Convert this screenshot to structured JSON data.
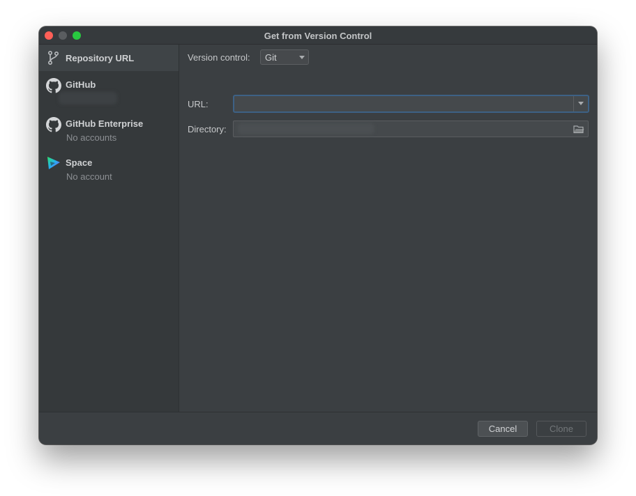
{
  "window": {
    "title": "Get from Version Control"
  },
  "sidebar": {
    "items": [
      {
        "label": "Repository URL",
        "sublabel": "",
        "icon": "branch-icon",
        "selected": true
      },
      {
        "label": "GitHub",
        "sublabel": "",
        "icon": "github-icon",
        "selected": false
      },
      {
        "label": "GitHub Enterprise",
        "sublabel": "No accounts",
        "icon": "github-icon",
        "selected": false
      },
      {
        "label": "Space",
        "sublabel": "No account",
        "icon": "space-logo-icon",
        "selected": false
      }
    ]
  },
  "form": {
    "version_control_label": "Version control:",
    "version_control_value": "Git",
    "url_label": "URL:",
    "url_value": "",
    "directory_label": "Directory:",
    "directory_value": ""
  },
  "footer": {
    "cancel_label": "Cancel",
    "clone_label": "Clone"
  },
  "colors": {
    "accent_focus": "#3d6185",
    "background": "#3b3f42",
    "sidebar": "#35393b"
  }
}
